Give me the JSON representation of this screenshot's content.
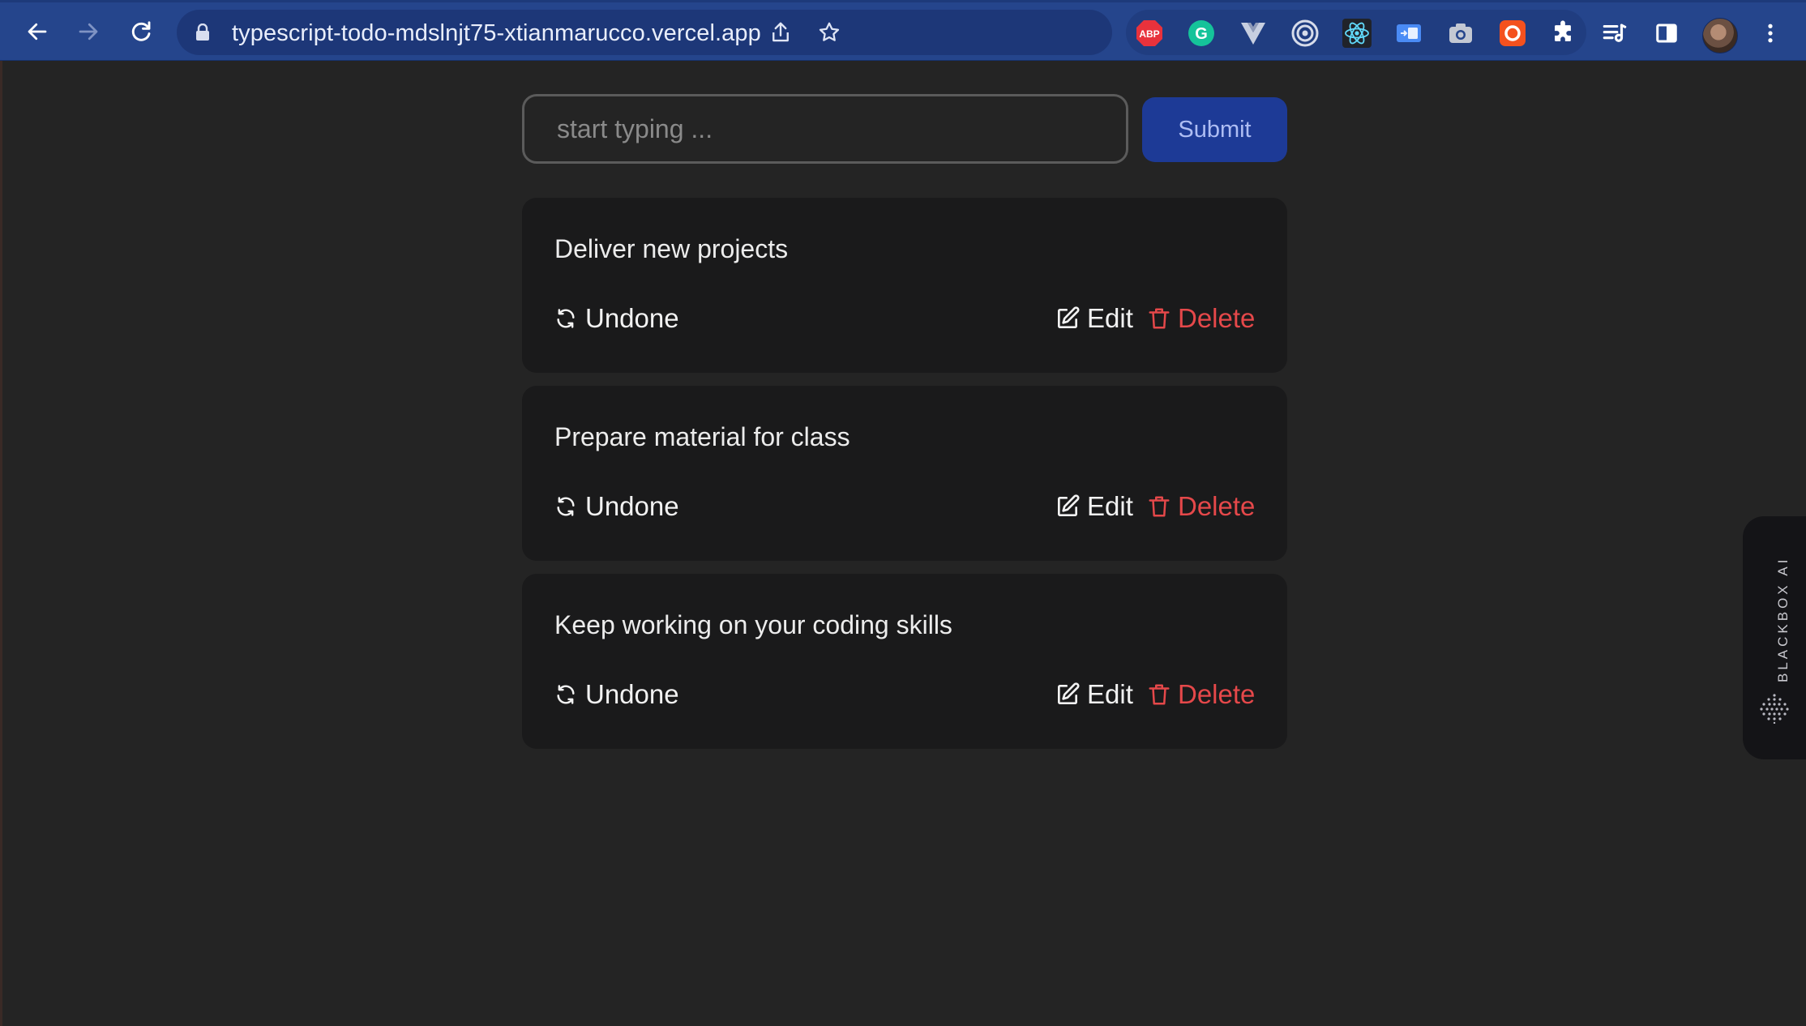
{
  "browser": {
    "url": "typescript-todo-mdslnjt75-xtianmarucco.vercel.app",
    "extensions": [
      {
        "name": "adblock-plus",
        "text": "ABP",
        "color": "#e8323c"
      },
      {
        "name": "grammarly",
        "text": "G",
        "color": "#15c39a"
      },
      {
        "name": "vue-devtools",
        "text": "",
        "color": "#c7cfe0"
      },
      {
        "name": "target-extension",
        "text": "",
        "color": "#d7dcea"
      },
      {
        "name": "react-devtools",
        "text": "",
        "color": "#61dafb"
      },
      {
        "name": "window-extension",
        "text": "",
        "color": "#4a8bf5"
      },
      {
        "name": "camera-extension",
        "text": "",
        "color": "#c3c8d3"
      },
      {
        "name": "red-extension",
        "text": "",
        "color": "#f4511e"
      }
    ]
  },
  "form": {
    "placeholder": "start typing ...",
    "value": "",
    "submit_label": "Submit"
  },
  "todos": [
    {
      "title": "Deliver new projects",
      "undone_label": "Undone",
      "edit_label": "Edit",
      "delete_label": "Delete"
    },
    {
      "title": "Prepare material for class",
      "undone_label": "Undone",
      "edit_label": "Edit",
      "delete_label": "Delete"
    },
    {
      "title": "Keep working on your coding skills",
      "undone_label": "Undone",
      "edit_label": "Edit",
      "delete_label": "Delete"
    }
  ],
  "side_panel": {
    "label": "BLACKBOX AI"
  },
  "colors": {
    "page_bg": "#242424",
    "card_bg": "#1a1a1b",
    "submit_bg": "#1d3a96",
    "delete_red": "#e5484a",
    "chrome_blue": "#25458c"
  }
}
